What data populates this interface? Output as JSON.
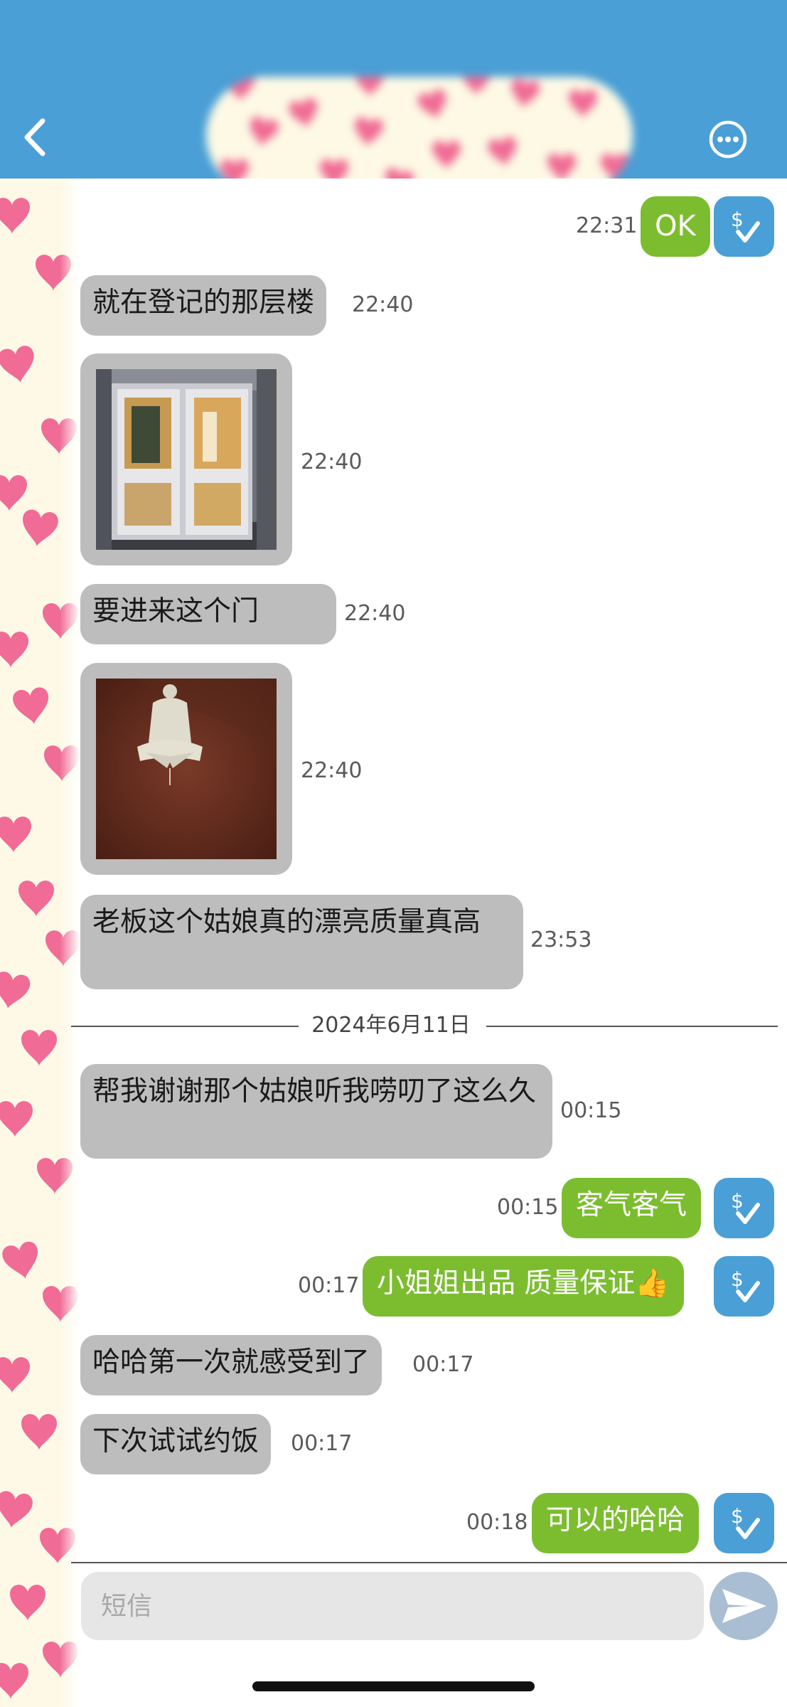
{
  "composer": {
    "placeholder": "短信"
  },
  "date_separator": "2024年6月11日",
  "messages": [
    {
      "dir": "out",
      "text": "OK",
      "time": "22:31"
    },
    {
      "dir": "in",
      "text": "就在登记的那层楼",
      "time": "22:40"
    },
    {
      "dir": "in",
      "type": "image",
      "time": "22:40"
    },
    {
      "dir": "in",
      "text": "要进来这个门",
      "time": "22:40"
    },
    {
      "dir": "in",
      "type": "image",
      "time": "22:40"
    },
    {
      "dir": "in",
      "text": "老板这个姑娘真的漂亮质量真高",
      "time": "23:53"
    },
    {
      "dir": "in",
      "text": "帮我谢谢那个姑娘听我唠叨了这么久",
      "time": "00:15"
    },
    {
      "dir": "out",
      "text": "客气客气",
      "time": "00:15"
    },
    {
      "dir": "out",
      "text": "小姐姐出品 质量保证👍",
      "time": "00:17"
    },
    {
      "dir": "in",
      "text": "哈哈第一次就感受到了",
      "time": "00:17"
    },
    {
      "dir": "in",
      "text": "下次试试约饭",
      "time": "00:17"
    },
    {
      "dir": "out",
      "text": "可以的哈哈",
      "time": "00:18"
    }
  ],
  "colors": {
    "header": "#4a9fd6",
    "incoming_bubble": "#bdbdbd",
    "outgoing_bubble": "#7cbd2f",
    "status_badge": "#4a9fd6",
    "send_button": "#a9bed3"
  },
  "icons": {
    "back": "chevron-left-icon",
    "more": "more-options-icon",
    "status": "sms-check-icon",
    "send": "send-icon"
  }
}
